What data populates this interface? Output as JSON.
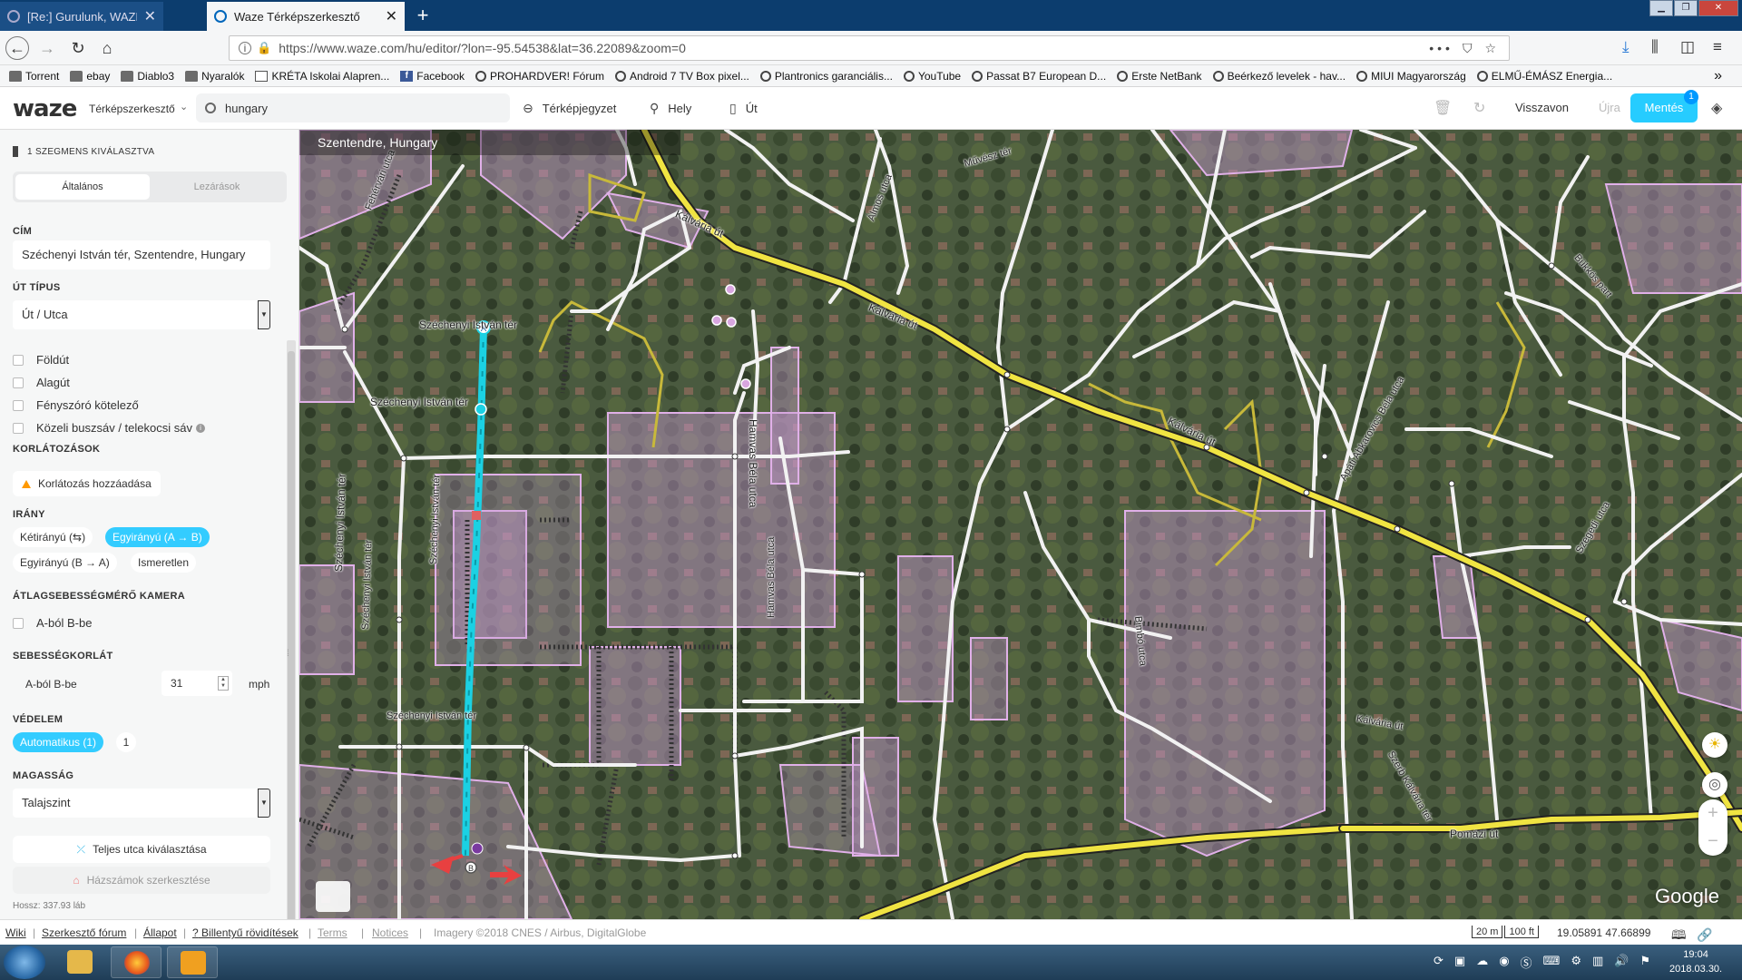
{
  "browser": {
    "tabs": [
      {
        "title": "[Re:] Gurulunk, WAZE?! - PROHARDVER! Fórum",
        "active": false
      },
      {
        "title": "Waze Térképszerkesztő",
        "active": true
      }
    ],
    "new_tab": "+",
    "url": "https://www.waze.com/hu/editor/?lon=-95.54538&lat=36.22089&zoom=0",
    "url_more": "•••",
    "bookmarks": [
      {
        "label": "Torrent",
        "icon": "folder"
      },
      {
        "label": "ebay",
        "icon": "folder"
      },
      {
        "label": "Diablo3",
        "icon": "folder"
      },
      {
        "label": "Nyaralók",
        "icon": "folder"
      },
      {
        "label": "KRÉTA Iskolai Alapren...",
        "icon": "doc"
      },
      {
        "label": "Facebook",
        "icon": "fb"
      },
      {
        "label": "PROHARDVER! Fórum",
        "icon": "globe"
      },
      {
        "label": "Android 7 TV Box pixel...",
        "icon": "globe"
      },
      {
        "label": "Plantronics garanciális...",
        "icon": "globe"
      },
      {
        "label": "YouTube",
        "icon": "globe"
      },
      {
        "label": "Passat B7 European D...",
        "icon": "globe"
      },
      {
        "label": "Erste NetBank",
        "icon": "globe"
      },
      {
        "label": "Beérkező levelek - hav...",
        "icon": "globe"
      },
      {
        "label": "MIUI Magyarország",
        "icon": "globe"
      },
      {
        "label": "ELMŰ-ÉMÁSZ Energia...",
        "icon": "globe"
      }
    ],
    "bookmarks_more": "»"
  },
  "wme": {
    "logo": "waze",
    "editor_label": "Térképszerkesztő",
    "search_value": "hungary",
    "tools": {
      "map_note": "Térképjegyzet",
      "place": "Hely",
      "road": "Út"
    },
    "undo": "Visszavon",
    "redo": "Újra",
    "save": "Mentés",
    "save_count": "1"
  },
  "sidebar": {
    "selection_header": "1 SZEGMENS KIVÁLASZTVA",
    "tabs": [
      "Általános",
      "Lezárások"
    ],
    "address_label": "CÍM",
    "address_value": "Széchenyi István tér, Szentendre, Hungary",
    "road_type_label": "ÚT TÍPUS",
    "road_type_value": "Út / Utca",
    "checkboxes": [
      "Földút",
      "Alagút",
      "Fényszóró kötelező",
      "Közeli buszsáv / telekocsi sáv"
    ],
    "restrictions_label": "KORLÁTOZÁSOK",
    "restrictions_button": "Korlátozás hozzáadása",
    "direction_label": "IRÁNY",
    "directions": [
      "Kétirányú (⇆)",
      "Egyirányú (A → B)",
      "Egyirányú (B → A)",
      "Ismeretlen"
    ],
    "direction_selected": "Egyirányú (A → B)",
    "camera_label": "ÁTLAGSEBESSÉGMÉRŐ KAMERA",
    "camera_check": "A-ból B-be",
    "speed_label": "SEBESSÉGKORLÁT",
    "speed_row_label": "A-ból B-be",
    "speed_value": "31",
    "speed_unit": "mph",
    "protection_label": "VÉDELEM",
    "protection_value": "Automatikus (1)",
    "protection_level": "1",
    "elevation_label": "MAGASSÁG",
    "elevation_value": "Talajszint",
    "select_street_button": "Teljes utca kiválasztása",
    "house_numbers_button": "Házszámok szerkesztése",
    "length_text": "Hossz: 337.93 láb"
  },
  "map": {
    "location": "Szentendre, Hungary",
    "google": "Google",
    "streets": [
      {
        "name": "Kálvária út"
      },
      {
        "name": "Széchenyi István tér"
      },
      {
        "name": "Hamvas Béla utca"
      },
      {
        "name": "Pomázi út"
      },
      {
        "name": "Bimbó utca"
      },
      {
        "name": "Szerb Kálvária tér"
      },
      {
        "name": "Művész tér"
      },
      {
        "name": "Álmos utca"
      },
      {
        "name": "Apáti Abkarovics Béla utca"
      },
      {
        "name": "Szegedi utca"
      },
      {
        "name": "Bükkös part"
      },
      {
        "name": "Fehérvári utca"
      }
    ],
    "node_a": "A",
    "node_b": "B",
    "zoom_in": "+",
    "zoom_out": "−"
  },
  "statusbar": {
    "links": [
      "Wiki",
      "Szerkesztő fórum",
      "Állapot",
      "Billentyű rövidítések",
      "Terms",
      "Notices"
    ],
    "imagery": "Imagery ©2018 CNES / Airbus, DigitalGlobe",
    "scale_m": "20 m",
    "scale_ft": "100 ft",
    "coords": "19.05891 47.66899"
  },
  "taskbar": {
    "time": "19:04",
    "date": "2018.03.30."
  },
  "colors": {
    "accent": "#26ccff",
    "selected_segment": "#1bd1e3",
    "primary_road": "#f0e442",
    "street": "#ffffff",
    "landmark": "#d8a6e0"
  }
}
